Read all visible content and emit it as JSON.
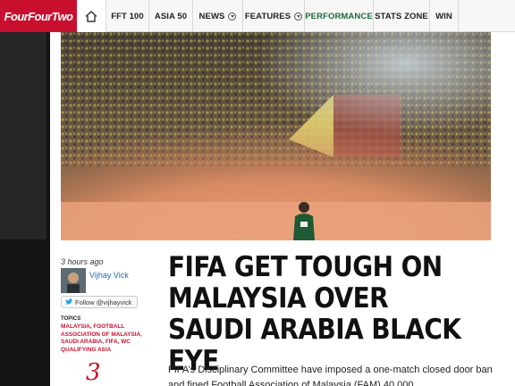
{
  "brand": {
    "logo_text": "FourFourTwo",
    "accent": "#c8102e"
  },
  "nav": {
    "items": [
      {
        "label": "FFT 100",
        "dropdown": false
      },
      {
        "label": "ASIA 50",
        "dropdown": false
      },
      {
        "label": "NEWS",
        "dropdown": true
      },
      {
        "label": "FEATURES",
        "dropdown": true
      },
      {
        "label": "PERFORMANCE",
        "dropdown": false
      },
      {
        "label": "STATS ZONE",
        "dropdown": false
      },
      {
        "label": "WIN",
        "dropdown": false
      }
    ]
  },
  "article": {
    "time_ago": "3 hours ago",
    "author": "Vijhay Vick",
    "follow_label": "Follow @vijhayvick",
    "topics_label": "TOPICS",
    "topics": "Malaysia, Football Association of Malaysia, Saudi Arabia, FIFA, WC Qualifying Asia",
    "count": "3",
    "headline": "FIFA GET TOUGH ON MALAYSIA OVER SAUDI ARABIA BLACK EYE",
    "body": "FIFA’s Disciplinary Committee have imposed a one-match closed door ban and fined Football Association of Malaysia (FAM) 40,000"
  },
  "icons": {
    "home": "home-icon",
    "twitter": "twitter-bird-icon",
    "dropdown": "chevron-down-circle-icon"
  }
}
